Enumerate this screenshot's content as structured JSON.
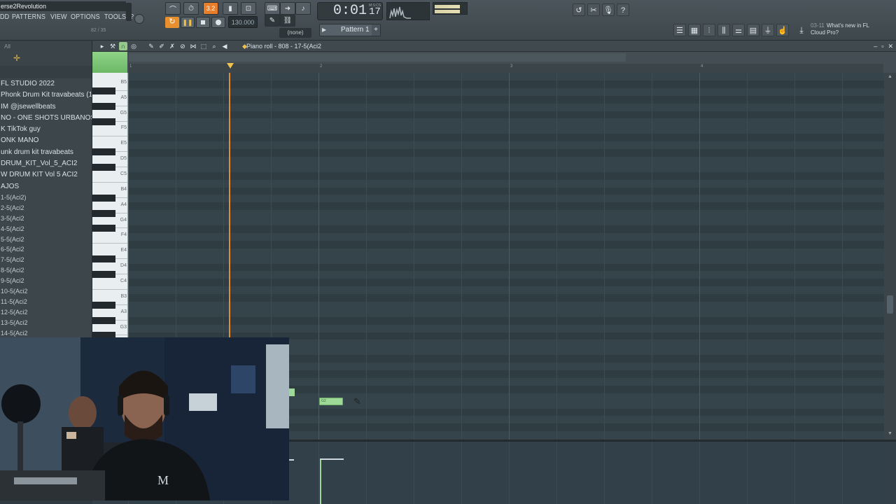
{
  "app": {
    "project_title": "erse2Revolution",
    "hint_text": "82 / 35"
  },
  "menu": {
    "items": [
      "DD",
      "PATTERNS",
      "VIEW",
      "OPTIONS",
      "TOOLS",
      "?"
    ]
  },
  "transport": {
    "tempo": "130.000",
    "time": "0:01",
    "time_sub": "17",
    "time_unit": "M:S:CS",
    "pattern_label": "Pattern 1",
    "pattern_none": "(none)",
    "mode_indicator": "3.2"
  },
  "news": {
    "number": "03-11",
    "line1": "What's new in FL",
    "line2": "Cloud Pro?"
  },
  "browser": {
    "all_label": "All",
    "items": [
      {
        "label": "FL STUDIO 2022",
        "type": "folder"
      },
      {
        "label": "Phonk Drum Kit travabeats (1)",
        "type": "folder"
      },
      {
        "label": "IM @jsewellbeats",
        "type": "folder"
      },
      {
        "label": "NO - ONE SHOTS URBANOS VOL. 2",
        "type": "folder"
      },
      {
        "label": "K TikTok guy",
        "type": "folder"
      },
      {
        "label": "ONK MANO",
        "type": "folder"
      },
      {
        "label": "unk drum kit travabeats",
        "type": "folder"
      },
      {
        "label": "DRUM_KIT_Vol_5_ACI2",
        "type": "folder"
      },
      {
        "label": "W DRUM KIT Vol 5 ACI2",
        "type": "folder"
      },
      {
        "label": "AJOS",
        "type": "folder"
      },
      {
        "label": "1-5(Aci2)",
        "type": "file"
      },
      {
        "label": "2-5(Aci2",
        "type": "file"
      },
      {
        "label": "3-5(Aci2",
        "type": "file"
      },
      {
        "label": "4-5(Aci2",
        "type": "file"
      },
      {
        "label": "5-5(Aci2",
        "type": "file"
      },
      {
        "label": "6-5(Aci2",
        "type": "file"
      },
      {
        "label": "7-5(Aci2",
        "type": "file"
      },
      {
        "label": "8-5(Aci2",
        "type": "file"
      },
      {
        "label": "9-5(Aci2",
        "type": "file"
      },
      {
        "label": "10-5(Aci2",
        "type": "file"
      },
      {
        "label": "11-5(Aci2",
        "type": "file"
      },
      {
        "label": "12-5(Aci2",
        "type": "file"
      },
      {
        "label": "13-5(Aci2",
        "type": "file"
      },
      {
        "label": "14-5(Aci2",
        "type": "file"
      }
    ]
  },
  "piano_roll": {
    "title": "Piano roll - 808 - 17-5(Aci2",
    "bar_numbers": [
      "1",
      "2",
      "3",
      "4"
    ],
    "key_labels": [
      "B5",
      "A5",
      "G5",
      "F5",
      "E5",
      "D5",
      "C5",
      "B4",
      "A4",
      "G4",
      "F4",
      "E4",
      "D4",
      "C4",
      "B3",
      "A3",
      "G3"
    ],
    "note_label": "G2"
  },
  "colors": {
    "accent_orange": "#e88b2f",
    "note_green": "#9fd997",
    "grid_bg": "#35434a"
  }
}
